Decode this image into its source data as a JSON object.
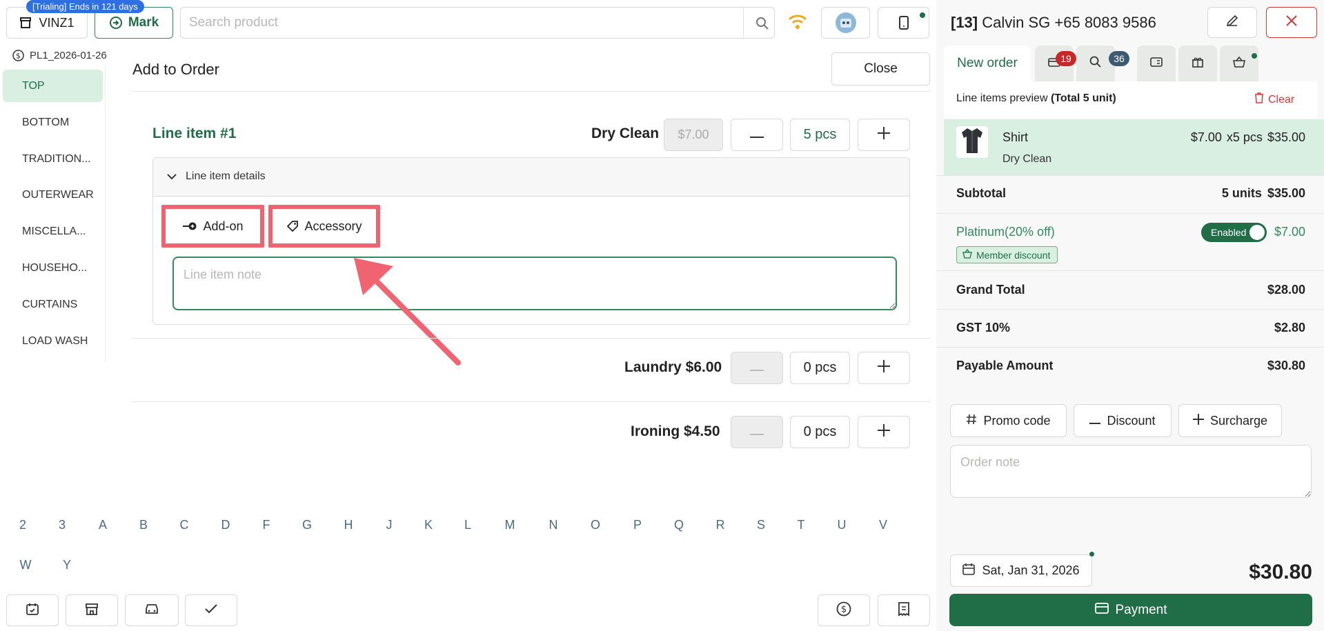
{
  "topbar": {
    "trial_badge": "[Trialing] Ends in 121 days",
    "store_label": "VINZ1",
    "mark_label": "Mark",
    "search_placeholder": "Search product",
    "price_list": "PL1_2026-01-26"
  },
  "categories": [
    "TOP",
    "BOTTOM",
    "TRADITION...",
    "OUTERWEAR",
    "MISCELLA...",
    "HOUSEHO...",
    "CURTAINS",
    "LOAD WASH"
  ],
  "add_to_order": {
    "title": "Add to Order",
    "close_label": "Close",
    "line_item_title": "Line item #1",
    "details_label": "Line item details",
    "addon_label": "Add-on",
    "accessory_label": "Accessory",
    "note_placeholder": "Line item note",
    "services": [
      {
        "name": "Dry Clean",
        "price": "$7.00",
        "qty": "5 pcs"
      },
      {
        "name": "Laundry $6.00",
        "qty": "0 pcs"
      },
      {
        "name": "Ironing $4.50",
        "qty": "0 pcs"
      }
    ]
  },
  "alphabet": [
    "2",
    "3",
    "A",
    "B",
    "C",
    "D",
    "F",
    "G",
    "H",
    "J",
    "K",
    "L",
    "M",
    "N",
    "O",
    "P",
    "Q",
    "R",
    "S",
    "T",
    "U",
    "V",
    "W",
    "Y"
  ],
  "order": {
    "customer_id": "[13]",
    "customer": "Calvin SG +65 8083 9586",
    "tab_new": "New order",
    "badge_wallet": "19",
    "badge_search": "36",
    "preview_label": "Line items preview",
    "preview_total": "(Total 5 unit)",
    "clear_label": "Clear",
    "item": {
      "name": "Shirt",
      "service": "Dry Clean",
      "price": "$7.00",
      "qty": "x5 pcs",
      "total": "$35.00"
    },
    "subtotal_label": "Subtotal",
    "subtotal_units": "5 units",
    "subtotal_value": "$35.00",
    "discount_label": "Platinum(20% off)",
    "discount_toggle": "Enabled",
    "discount_value": "$7.00",
    "member_chip": "Member discount",
    "grand_total_label": "Grand Total",
    "grand_total_value": "$28.00",
    "gst_label": "GST 10%",
    "gst_value": "$2.80",
    "payable_label": "Payable Amount",
    "payable_value": "$30.80",
    "promo_label": "Promo code",
    "discount_btn_label": "Discount",
    "surcharge_label": "Surcharge",
    "order_note_placeholder": "Order note",
    "date_label": "Sat, Jan 31, 2026",
    "total_display": "$30.80",
    "payment_label": "Payment"
  },
  "colors": {
    "accent": "#1f6e48",
    "highlight": "#ef6470",
    "trial": "#2f6fe4",
    "wifi": "#f2a81c",
    "danger": "#d23a3a"
  }
}
